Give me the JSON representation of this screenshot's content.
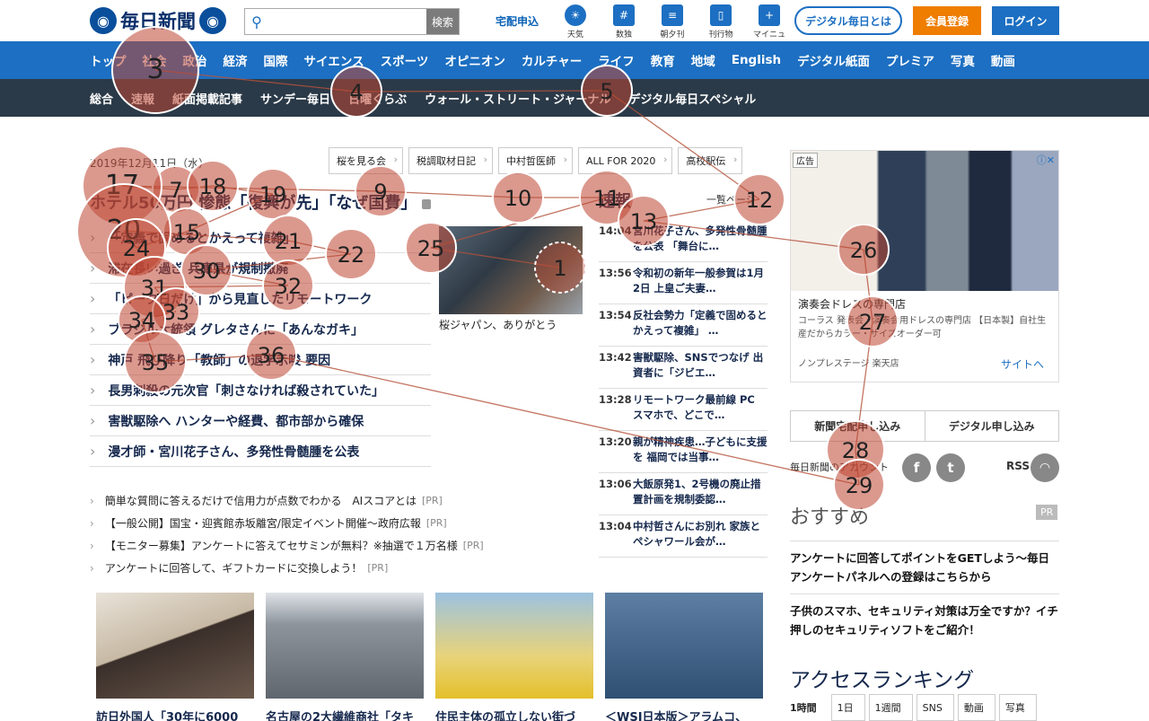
{
  "header": {
    "logo": "毎日新聞",
    "search_button": "検索",
    "delivery": "宅配申込",
    "tools": [
      {
        "label": "天気",
        "icon": "weather-icon"
      },
      {
        "label": "数独",
        "icon": "sudoku-icon"
      },
      {
        "label": "朝夕刊",
        "icon": "newspaper-icon"
      },
      {
        "label": "刊行物",
        "icon": "book-icon"
      },
      {
        "label": "マイニュース",
        "icon": "my-news-icon"
      }
    ],
    "btn_digital": "デジタル毎日とは",
    "btn_register": "会員登録",
    "btn_login": "ログイン"
  },
  "nav1": [
    "トップ",
    "社会",
    "政治",
    "経済",
    "国際",
    "サイエンス",
    "スポーツ",
    "オピニオン",
    "カルチャー",
    "ライフ",
    "教育",
    "地域",
    "English",
    "デジタル紙面",
    "プレミア",
    "写真",
    "動画"
  ],
  "nav2": [
    "総合",
    "速報",
    "紙面掲載記事",
    "サンデー毎日",
    "日曜くらぶ",
    "ウォール・ストリート・ジャーナル",
    "デジタル毎日スペシャル"
  ],
  "date": "2019年12月11日（水）",
  "tags": [
    "桜を見る会",
    "税調取材日記",
    "中村哲医師",
    "ALL FOR 2020",
    "高校駅伝"
  ],
  "headline": "ホテル50万円 惨態「復興が先」「なぜ国費」",
  "news": [
    "「定義で固めるとかえって複雑」",
    "滞在長い過ぎ 兵庫県が規制撤廃",
    "「ピーク日だけ」から見直したリモートワーク",
    "ブラジル大統領 グレタさんに「あんなガキ」",
    "神戸 飛び降り「教師」の退学示唆 要因",
    "長男刺殺の元次官「刺さなければ殺されていた」",
    "害獣駆除へ ハンターや経費、都市部から確保",
    "漫才師・宮川花子さん、多発性骨髄腫を公表"
  ],
  "photo_caption": "桜ジャパン、ありがとう",
  "flash": {
    "title": "速報",
    "more": "一覧ページ",
    "items": [
      {
        "time": "14:04",
        "text": "宮川花子さん、多発性骨髄腫を公表 「舞台に…"
      },
      {
        "time": "13:56",
        "text": "令和初の新年一般参賀は1月2日 上皇ご夫妻…"
      },
      {
        "time": "13:54",
        "text": "反社会勢力「定義で固めるとかえって複雑」 …"
      },
      {
        "time": "13:42",
        "text": "害獣駆除、SNSでつなげ 出資者に「ジビエ…"
      },
      {
        "time": "13:28",
        "text": "リモートワーク最前線 PC スマホで、どこで…"
      },
      {
        "time": "13:20",
        "text": "親が精神疾患…子どもに支援を 福岡では当事…"
      },
      {
        "time": "13:06",
        "text": "大飯原発1、2号機の廃止措置計画を規制委認…"
      },
      {
        "time": "13:04",
        "text": "中村哲さんにお別れ 家族とペシャワール会が…"
      }
    ]
  },
  "pr_items": [
    "簡単な質問に答えるだけで信用力が点数でわかる　AIスコアとは",
    "【一般公開】国宝・迎賓館赤坂離宮/限定イベント開催〜政府広報",
    "【モニター募集】アンケートに答えてセサミンが無料？※抽選で１万名様",
    "アンケートに回答して、ギフトカードに交換しよう！"
  ],
  "pr_tag": "[PR]",
  "thumbs": [
    {
      "caption": "訪日外国人「30年に6000"
    },
    {
      "caption": "名古屋の2大繊維商社「タキ"
    },
    {
      "caption": "住民主体の孤立しない街づ"
    },
    {
      "caption": "＜WSJ日本版＞アラムコ、"
    }
  ],
  "ad": {
    "label": "広告",
    "title": "演奏会ドレスの専門店",
    "desc": "コーラス 発表会・演奏会用ドレスの専門店 【日本製】自社生産だからカラー・サイズオーダー可",
    "shop": "ノンプレステージ 楽天店",
    "link": "サイトへ"
  },
  "subscribe": [
    "新聞宅配申し込み",
    "デジタル申し込み"
  ],
  "account": "毎日新聞のアカウント",
  "rss": "RSS",
  "recommend": {
    "title": "おすすめ",
    "pr": "PR",
    "items": [
      "アンケートに回答してポイントをGETしよう〜毎日アンケートパネルへの登録はこちらから",
      "子供のスマホ、セキュリティ対策は万全ですか？イチ押しのセキュリティソフトをご紹介！"
    ]
  },
  "ranking": {
    "title": "アクセスランキング",
    "tabs": [
      "1時間",
      "1日",
      "1週間",
      "SNS",
      "動画",
      "写真"
    ]
  },
  "fixations": [
    "1",
    "3",
    "4",
    "5",
    "7",
    "9",
    "10",
    "11",
    "12",
    "13",
    "15",
    "17",
    "18",
    "19",
    "20",
    "21",
    "22",
    "24",
    "25",
    "26",
    "27",
    "28",
    "29",
    "30",
    "31",
    "32",
    "33",
    "34",
    "35",
    "36"
  ]
}
